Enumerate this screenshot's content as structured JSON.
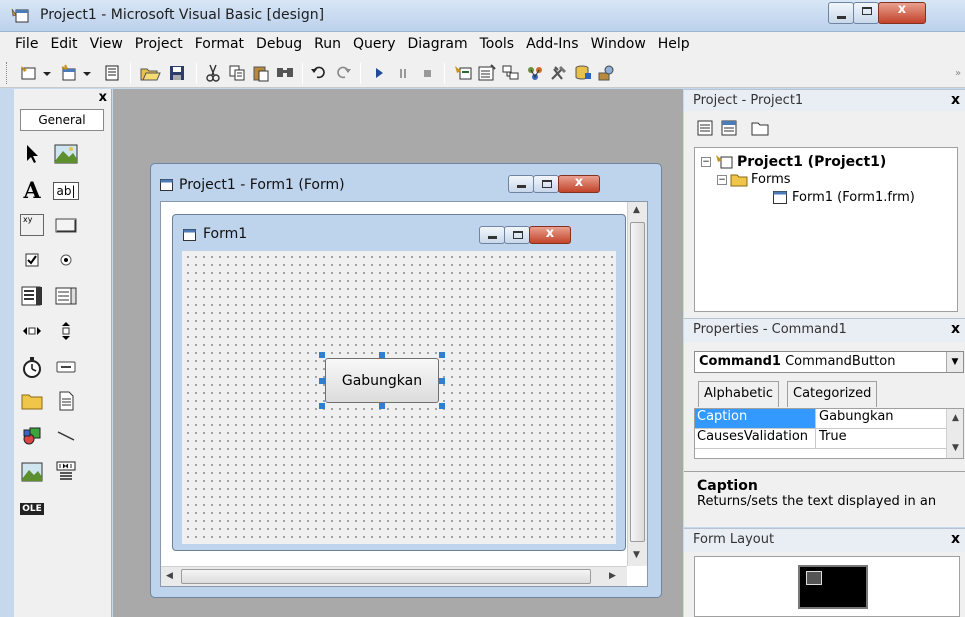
{
  "window": {
    "title": "Project1 - Microsoft Visual Basic [design]",
    "close_glyph": "x"
  },
  "menu": [
    "File",
    "Edit",
    "View",
    "Project",
    "Format",
    "Debug",
    "Run",
    "Query",
    "Diagram",
    "Tools",
    "Add-Ins",
    "Window",
    "Help"
  ],
  "toolbar": {
    "icons": [
      "add-project-icon",
      "add-form-icon",
      "menu-editor-icon",
      "open-project-icon",
      "save-project-icon",
      "cut-icon",
      "copy-icon",
      "paste-icon",
      "find-icon",
      "undo-icon",
      "redo-icon",
      "start-icon",
      "break-icon",
      "end-icon",
      "project-explorer-icon",
      "properties-window-icon",
      "form-layout-icon",
      "object-browser-icon",
      "toolbox-icon",
      "data-view-icon",
      "component-manager-icon"
    ],
    "overflow": "»"
  },
  "toolbox": {
    "close_glyph": "x",
    "tab_label": "General",
    "tools": [
      "pointer-icon",
      "picturebox-icon",
      "label-icon",
      "textbox-icon",
      "frame-icon",
      "commandbutton-icon",
      "checkbox-icon",
      "optionbutton-icon",
      "combobox-icon",
      "listbox-icon",
      "hscrollbar-icon",
      "vscrollbar-icon",
      "timer-icon",
      "drivelistbox-icon",
      "dirlistbox-icon",
      "filelistbox-icon",
      "shape-icon",
      "line-icon",
      "image-icon",
      "data-icon",
      "ole-icon"
    ],
    "label_glyph": "A",
    "textbox_glyph": "ab|",
    "frame_glyph": "xy",
    "ole_label": "OLE"
  },
  "designer": {
    "window_title": "Project1 - Form1 (Form)",
    "form_title": "Form1",
    "command_button": "Gabungkan",
    "close_glyph": "x"
  },
  "project_panel": {
    "title": "Project - Project1",
    "close_glyph": "x",
    "tree": {
      "project": "Project1 (Project1)",
      "folder": "Forms",
      "form": "Form1 (Form1.frm)"
    }
  },
  "properties_panel": {
    "title": "Properties - Command1",
    "close_glyph": "x",
    "object_name": "Command1",
    "object_type": "CommandButton",
    "tabs": [
      "Alphabetic",
      "Categorized"
    ],
    "rows": [
      {
        "name": "Caption",
        "value": "Gabungkan"
      },
      {
        "name": "CausesValidation",
        "value": "True"
      }
    ],
    "description_title": "Caption",
    "description": "Returns/sets the text displayed in an"
  },
  "layout_panel": {
    "title": "Form Layout",
    "close_glyph": "x"
  },
  "colors": {
    "selection": "#3399ff",
    "handle": "#2f7fd0",
    "mdi_background": "#a9a9a9"
  }
}
